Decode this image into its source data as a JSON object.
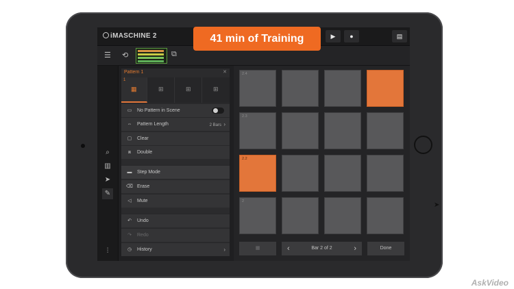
{
  "banner": {
    "text": "41 min of Training"
  },
  "app": {
    "name": "iMASCHINE 2"
  },
  "transport": {
    "play_icon": "play-icon",
    "record_icon": "record-icon",
    "settings_icon": "keyboard-icon"
  },
  "pattern_panel": {
    "title": "Pattern 1",
    "slot_number": "1",
    "items": {
      "no_pattern": "No Pattern in Scene",
      "pattern_length": "Pattern Length",
      "pattern_length_value": "2 Bars",
      "clear": "Clear",
      "double": "Double",
      "step_mode": "Step Mode",
      "erase": "Erase",
      "mute": "Mute",
      "undo": "Undo",
      "redo": "Redo",
      "history": "History"
    }
  },
  "pads": {
    "row_labels": [
      "2.4",
      "2.3",
      "2.2",
      "2"
    ],
    "active": [
      [
        0,
        3
      ],
      [
        2,
        0
      ]
    ]
  },
  "footer": {
    "bar_text": "Bar 2 of 2",
    "done": "Done"
  },
  "watermark": "AskVideo",
  "colors": {
    "accent": "#e3763a",
    "banner": "#ef6a22",
    "pad": "#58585a"
  }
}
